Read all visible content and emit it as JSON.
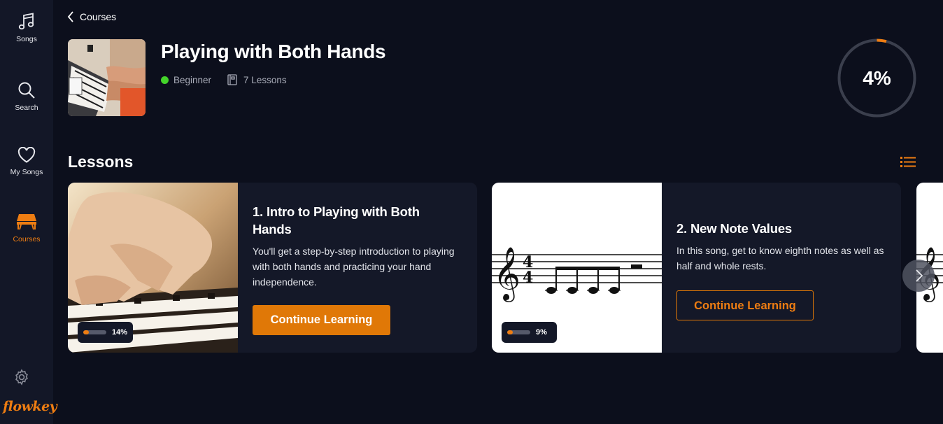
{
  "sidebar": {
    "items": [
      {
        "label": "Songs",
        "icon": "music-note-icon"
      },
      {
        "label": "Search",
        "icon": "search-icon"
      },
      {
        "label": "My Songs",
        "icon": "heart-icon"
      },
      {
        "label": "Courses",
        "icon": "courses-icon",
        "active": true
      }
    ],
    "logo": "flowkey"
  },
  "breadcrumb": {
    "label": "Courses"
  },
  "course": {
    "title": "Playing with Both Hands",
    "level": "Beginner",
    "lessons_count": "7 Lessons",
    "progress_label": "4%",
    "progress_value": 0.04
  },
  "lessons": {
    "heading": "Lessons",
    "items": [
      {
        "title": "1. Intro to Playing with Both Hands",
        "description": "You'll get a step-by-step introduction to playing with both hands and practicing your hand independence.",
        "button": "Continue Learning",
        "progress_label": "14%",
        "progress_value": 0.14
      },
      {
        "title": "2. New Note Values",
        "description": "In this song, get to know eighth notes as well as half and whole rests.",
        "button": "Continue Learning",
        "progress_label": "9%",
        "progress_value": 0.09
      }
    ]
  },
  "colors": {
    "accent": "#ee7d12",
    "background": "#0c0f1c",
    "sidebar": "#131727",
    "card": "#141828",
    "level_dot": "#44d42a"
  }
}
